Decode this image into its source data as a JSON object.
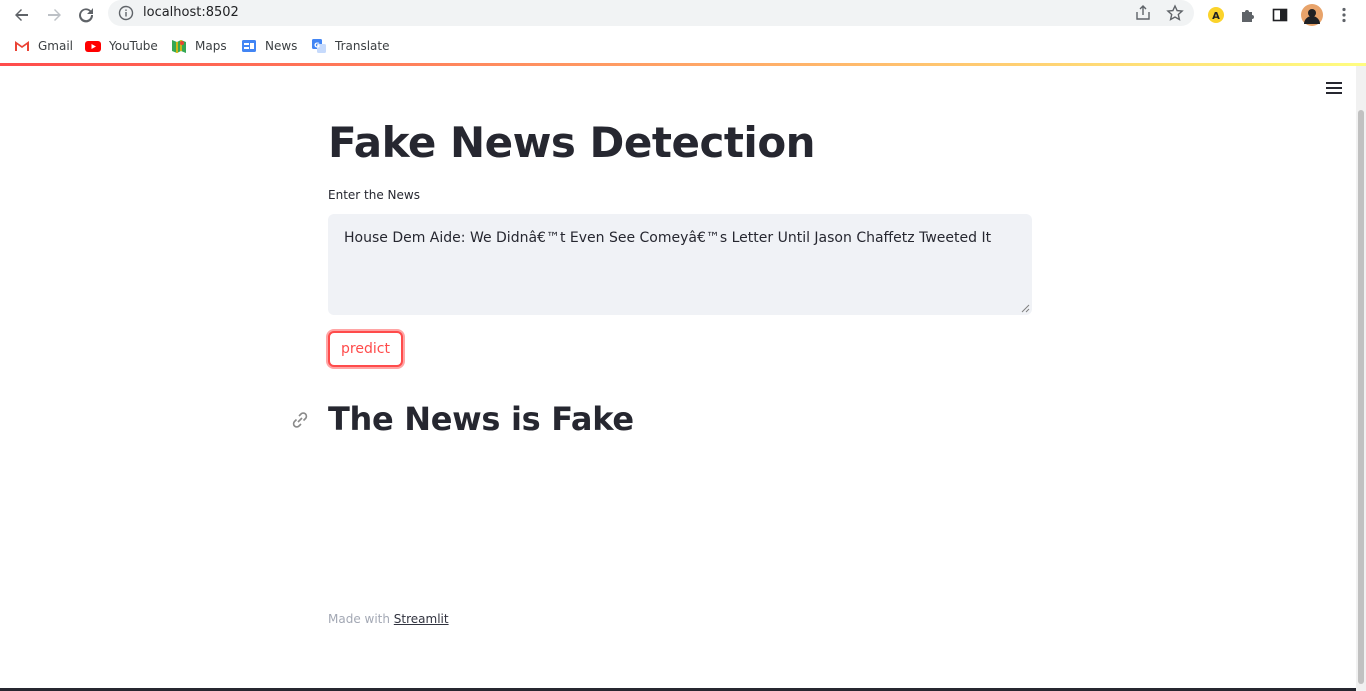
{
  "browser": {
    "url": "localhost:8502",
    "bookmarks": [
      {
        "label": "Gmail",
        "icon": "gmail-icon"
      },
      {
        "label": "YouTube",
        "icon": "youtube-icon"
      },
      {
        "label": "Maps",
        "icon": "maps-icon"
      },
      {
        "label": "News",
        "icon": "news-icon"
      },
      {
        "label": "Translate",
        "icon": "translate-icon"
      }
    ]
  },
  "app": {
    "title": "Fake News Detection",
    "input_label": "Enter the News",
    "input_value": "House Dem Aide: We Didnâ€™t Even See Comeyâ€™s Letter Until Jason Chaffetz Tweeted It",
    "button_label": "predict",
    "result": "The News is Fake",
    "footer_prefix": "Made with ",
    "footer_brand": "Streamlit"
  },
  "colors": {
    "accent": "#ff4b4b",
    "text": "#262730",
    "input_bg": "#f0f2f6"
  }
}
